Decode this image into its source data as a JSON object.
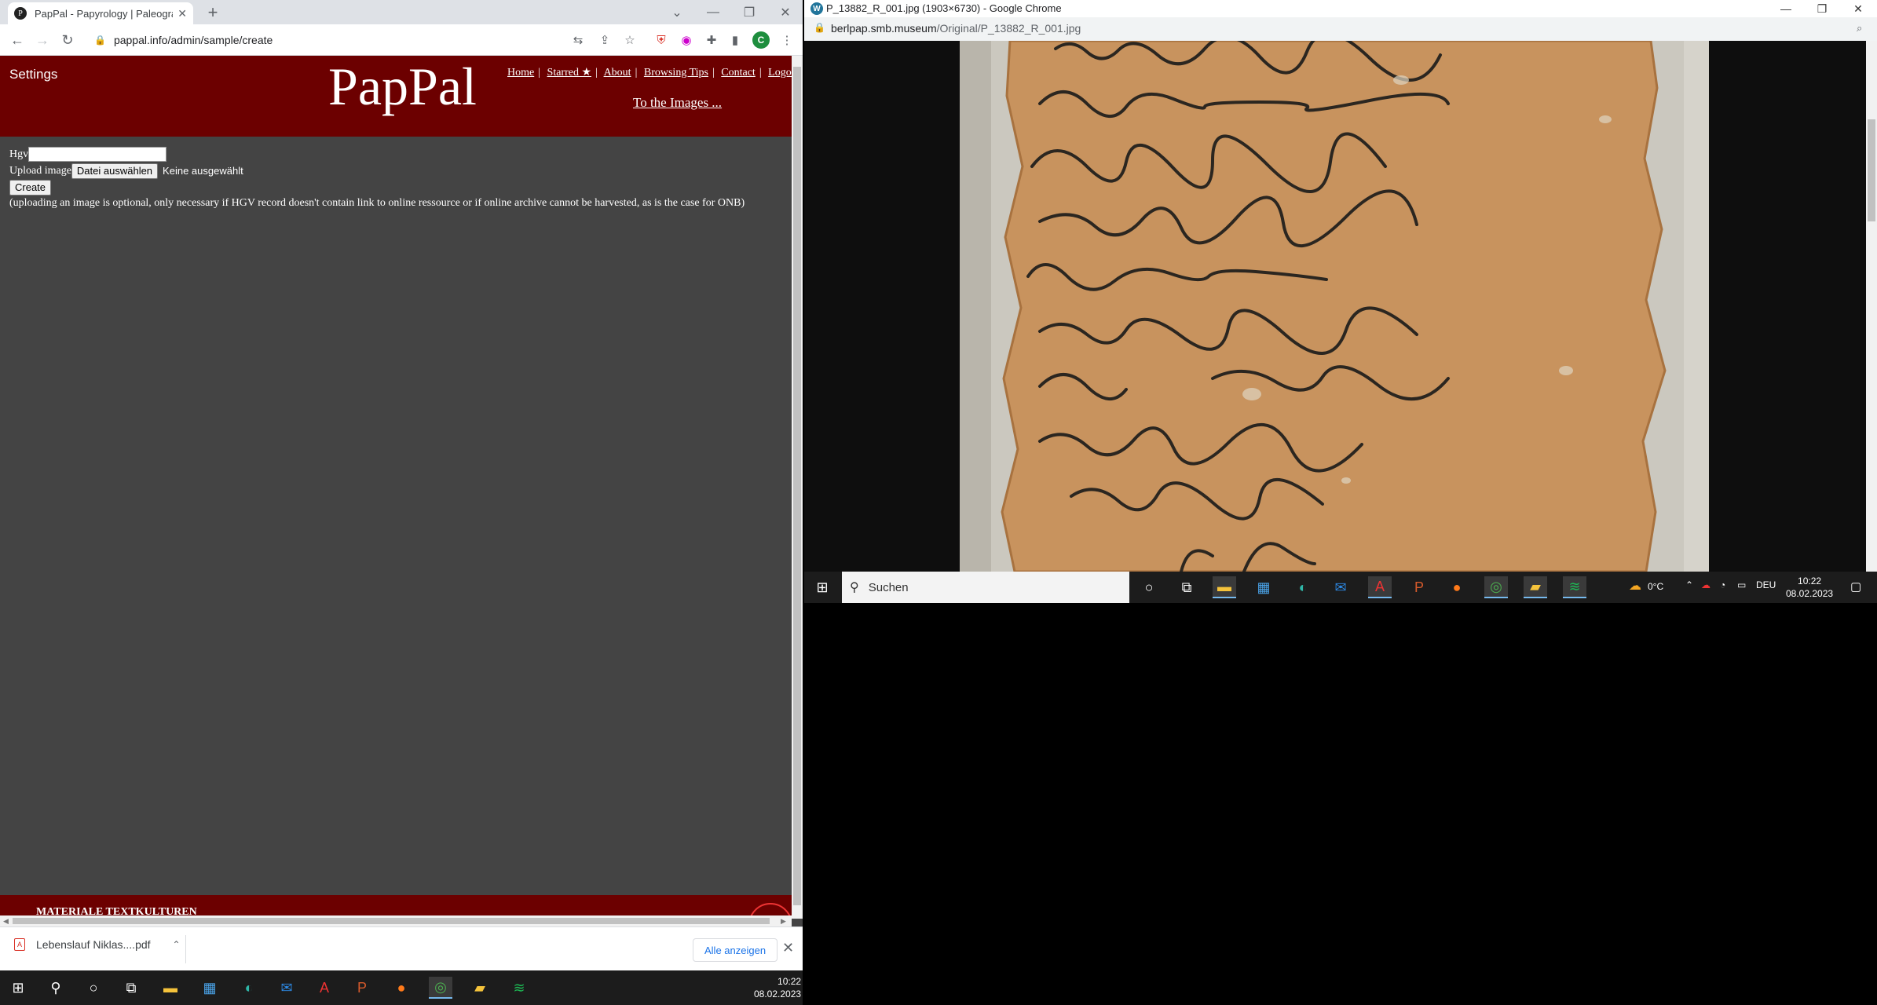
{
  "left_browser": {
    "tab_title": "PapPal - Papyrology | Paleography",
    "tab_favicon": "P",
    "url": "pappal.info/admin/sample/create",
    "profile_initial": "C"
  },
  "site": {
    "settings_label": "Settings",
    "logo": "PapPal",
    "nav": [
      "Home",
      "Starred ★",
      "About",
      "Browsing Tips",
      "Contact",
      "Logout"
    ],
    "images_link": "To the Images ...",
    "form": {
      "hgv_label": "Hgv",
      "upload_label": "Upload image",
      "file_button": "Datei auswählen",
      "file_status": "Keine ausgewählt",
      "create_button": "Create",
      "note": "(uploading an image is optional, only necessary if HGV record doesn't contain link to online ressource or if online archive cannot be harvested, as is the case for ONB)"
    },
    "footer_text": "Materiale Textkulturen"
  },
  "downloads": {
    "file_name": "Lebenslauf Niklas....pdf",
    "show_all": "Alle anzeigen"
  },
  "taskbar_left": {
    "time": "10:22",
    "date": "08.02.2023"
  },
  "right_browser": {
    "title": "P_13882_R_001.jpg (1903×6730) - Google Chrome",
    "url_host": "berlpap.smb.museum",
    "url_path": "/Original/P_13882_R_001.jpg"
  },
  "taskbar_right": {
    "search_placeholder": "Suchen",
    "weather": "0°C",
    "language": "DEU",
    "time": "10:22",
    "date": "08.02.2023"
  },
  "colors": {
    "header_red": "#6c0000",
    "page_gray": "#444444",
    "papyrus": "#c8935e"
  }
}
